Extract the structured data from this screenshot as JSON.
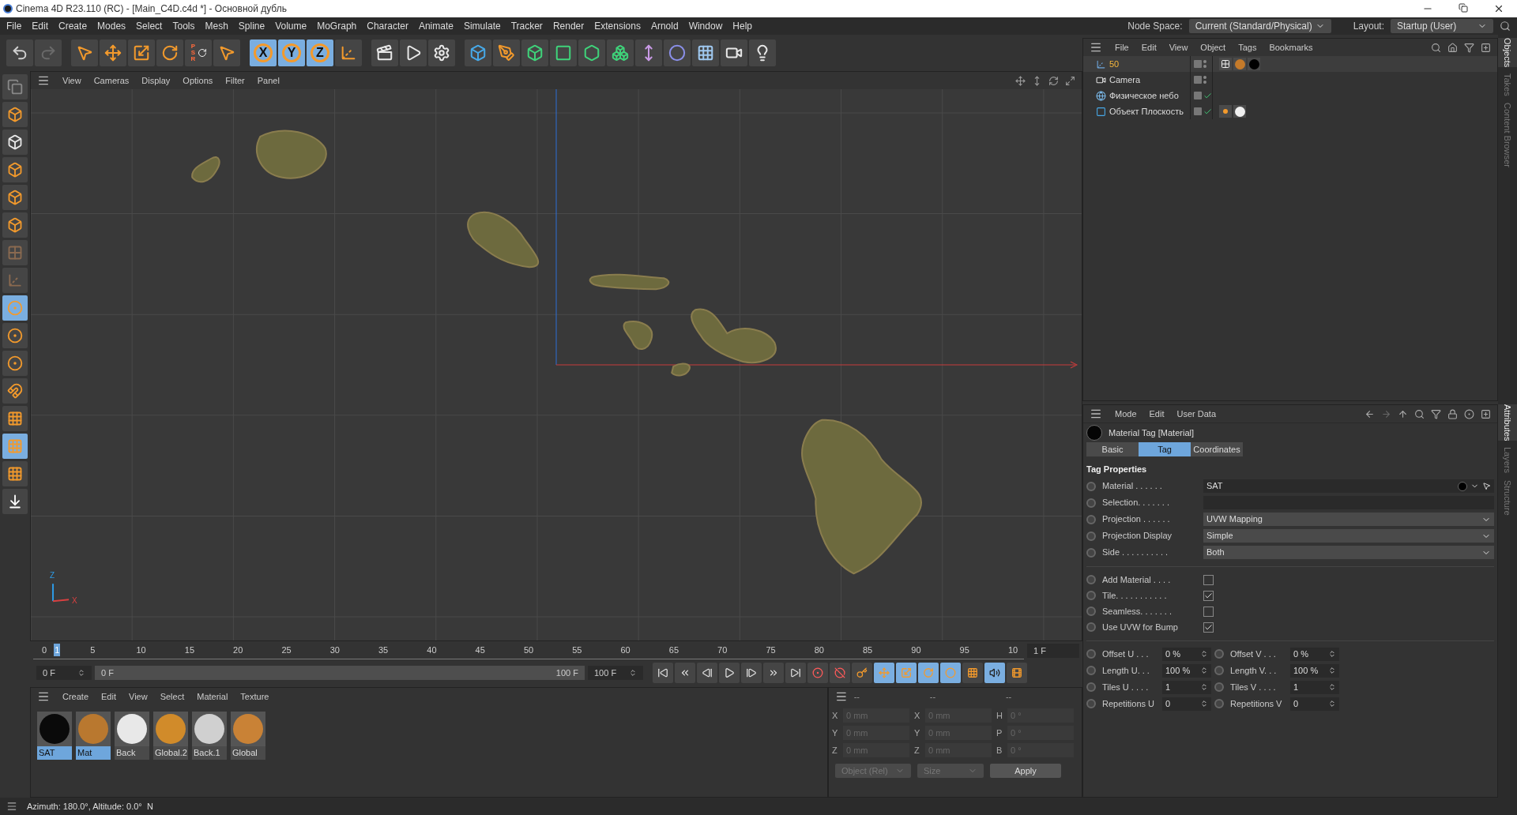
{
  "window": {
    "title": "Cinema 4D R23.110 (RC) - [Main_C4D.c4d *] - Основной дубль"
  },
  "menu": [
    "File",
    "Edit",
    "Create",
    "Modes",
    "Select",
    "Tools",
    "Mesh",
    "Spline",
    "Volume",
    "MoGraph",
    "Character",
    "Animate",
    "Simulate",
    "Tracker",
    "Render",
    "Extensions",
    "Arnold",
    "Window",
    "Help"
  ],
  "node_space": {
    "label": "Node Space:",
    "value": "Current (Standard/Physical)"
  },
  "layout": {
    "label": "Layout:",
    "value": "Startup (User)"
  },
  "toolbar": [
    {
      "kind": "undo",
      "selected": false
    },
    {
      "kind": "redo",
      "selected": false
    },
    {
      "kind": "select",
      "selected": false
    },
    {
      "kind": "move",
      "selected": false
    },
    {
      "kind": "scale",
      "selected": false
    },
    {
      "kind": "rotate",
      "selected": false
    },
    {
      "kind": "psr",
      "label": "PSR",
      "selected": false
    },
    {
      "kind": "live",
      "selected": false
    },
    {
      "kind": "axis",
      "label": "X",
      "selected": true
    },
    {
      "kind": "axis",
      "label": "Y",
      "selected": true
    },
    {
      "kind": "axis",
      "label": "Z",
      "selected": true
    },
    {
      "kind": "coord",
      "selected": false
    },
    {
      "kind": "render-view",
      "selected": false
    },
    {
      "kind": "render",
      "selected": false
    },
    {
      "kind": "render-settings",
      "selected": false
    },
    {
      "kind": "cube",
      "selected": false
    },
    {
      "kind": "pen",
      "selected": false
    },
    {
      "kind": "subdivision",
      "selected": false
    },
    {
      "kind": "extrude",
      "selected": false
    },
    {
      "kind": "cloner",
      "selected": false
    },
    {
      "kind": "array",
      "selected": false
    },
    {
      "kind": "deformer",
      "selected": false
    },
    {
      "kind": "field",
      "selected": false
    },
    {
      "kind": "floor",
      "selected": false
    },
    {
      "kind": "camera",
      "selected": false
    },
    {
      "kind": "light",
      "selected": false
    }
  ],
  "left_toolbar": [
    {
      "kind": "editable",
      "selected": false
    },
    {
      "kind": "model",
      "selected": false
    },
    {
      "kind": "texture",
      "selected": false
    },
    {
      "kind": "points",
      "selected": false
    },
    {
      "kind": "edges",
      "selected": false
    },
    {
      "kind": "polygons",
      "selected": false
    },
    {
      "kind": "uv",
      "selected": false
    },
    {
      "kind": "axis",
      "selected": false
    },
    {
      "kind": "snap",
      "selected": true
    },
    {
      "kind": "snap",
      "selected": false
    },
    {
      "kind": "snap",
      "selected": false
    },
    {
      "kind": "magnet",
      "selected": false
    },
    {
      "kind": "workplane",
      "selected": false
    },
    {
      "kind": "workplane",
      "selected": true
    },
    {
      "kind": "workplane",
      "selected": false
    },
    {
      "kind": "drop",
      "selected": false
    }
  ],
  "viewport": {
    "menu": [
      "View",
      "Cameras",
      "Display",
      "Options",
      "Filter",
      "Panel"
    ],
    "axis_labels": [
      "Z",
      "X"
    ]
  },
  "timeline": {
    "ticks": [
      "0",
      "5",
      "10",
      "15",
      "20",
      "25",
      "30",
      "35",
      "40",
      "45",
      "50",
      "55",
      "60",
      "65",
      "70",
      "75",
      "80",
      "85",
      "90",
      "95",
      "10"
    ],
    "current": {
      "label": "1",
      "level": 0.01
    },
    "frame_field": "1 F",
    "start": "0 F",
    "range": {
      "start": "0 F",
      "end": "100 F",
      "level": 1
    },
    "end": "100 F",
    "transport": [
      {
        "kind": "first",
        "selected": false
      },
      {
        "kind": "prev-key",
        "selected": false
      },
      {
        "kind": "prev",
        "selected": false
      },
      {
        "kind": "play",
        "selected": false
      },
      {
        "kind": "next",
        "selected": false
      },
      {
        "kind": "next-key",
        "selected": false
      },
      {
        "kind": "last",
        "selected": false
      },
      {
        "kind": "record",
        "selected": false
      },
      {
        "kind": "autokey",
        "selected": false
      },
      {
        "kind": "keysel",
        "selected": false
      },
      {
        "kind": "key-move",
        "selected": true
      },
      {
        "kind": "key-scale",
        "selected": true
      },
      {
        "kind": "key-rotate",
        "selected": true
      },
      {
        "kind": "key-param",
        "selected": true
      },
      {
        "kind": "key-points",
        "selected": false
      },
      {
        "kind": "sound",
        "selected": true
      },
      {
        "kind": "film",
        "selected": false
      }
    ]
  },
  "materials": {
    "menu": [
      "Create",
      "Edit",
      "View",
      "Select",
      "Material",
      "Texture"
    ],
    "items": [
      {
        "name": "SAT",
        "color": "#0a0a0a",
        "selected": true
      },
      {
        "name": "Mat",
        "color": "#b9782f",
        "selected": true
      },
      {
        "name": "Back",
        "color": "#e8e8e8",
        "selected": false
      },
      {
        "name": "Global.2",
        "color": "#d18b2a",
        "selected": false
      },
      {
        "name": "Back.1",
        "color": "#d0d0d0",
        "selected": false
      },
      {
        "name": "Global",
        "color": "#c98236",
        "selected": false
      }
    ]
  },
  "coordinates": {
    "headers": [
      "--",
      "--",
      "--"
    ],
    "rows": [
      [
        {
          "axis": "X",
          "value": "0 mm"
        },
        {
          "axis": "X",
          "value": "0 mm"
        },
        {
          "axis": "H",
          "value": "0 °"
        }
      ],
      [
        {
          "axis": "Y",
          "value": "0 mm"
        },
        {
          "axis": "Y",
          "value": "0 mm"
        },
        {
          "axis": "P",
          "value": "0 °"
        }
      ],
      [
        {
          "axis": "Z",
          "value": "0 mm"
        },
        {
          "axis": "Z",
          "value": "0 mm"
        },
        {
          "axis": "B",
          "value": "0 °"
        }
      ]
    ],
    "disabled": true,
    "mode": "Object (Rel)",
    "size": "Size",
    "apply": "Apply"
  },
  "objects": {
    "menu": [
      "File",
      "Edit",
      "View",
      "Object",
      "Tags",
      "Bookmarks"
    ],
    "items": [
      {
        "name": "50",
        "kind": "null",
        "selected": true,
        "check": false,
        "tags": [
          {
            "kind": "checker"
          },
          {
            "kind": "orange-ball"
          },
          {
            "kind": "black-ball"
          }
        ]
      },
      {
        "name": "Camera",
        "kind": "camera",
        "selected": false,
        "check": false
      },
      {
        "name": "Физическое небо",
        "kind": "sky",
        "selected": false,
        "check": true
      },
      {
        "name": "Объект Плоскость",
        "kind": "plane",
        "selected": false,
        "check": true,
        "tags": [
          {
            "kind": "dots"
          },
          {
            "kind": "white-ball"
          }
        ]
      }
    ]
  },
  "right_tabs_top": [
    {
      "label": "Objects",
      "selected": true
    },
    {
      "label": "Takes",
      "selected": false
    },
    {
      "label": "Content Browser",
      "selected": false
    }
  ],
  "attributes": {
    "menu": [
      "Mode",
      "Edit",
      "User Data"
    ],
    "title": "Material Tag [Material]",
    "tabs": [
      {
        "label": "Basic",
        "selected": false
      },
      {
        "label": "Tag",
        "selected": true
      },
      {
        "label": "Coordinates",
        "selected": false
      }
    ],
    "section": "Tag Properties",
    "fields": [
      {
        "kind": "link",
        "label": "Material . . . . . .",
        "value": "SAT"
      },
      {
        "kind": "text",
        "label": "Selection. . . . . . ."
      },
      {
        "kind": "dropdown",
        "label": "Projection . . . . . .",
        "value": "UVW Mapping"
      },
      {
        "kind": "dropdown",
        "label": "Projection Display",
        "value": "Simple"
      },
      {
        "kind": "dropdown",
        "label": "Side . . . . . . . . . .",
        "value": "Both"
      }
    ],
    "checks": [
      {
        "label": "Add Material . . . .",
        "checked": false
      },
      {
        "label": "Tile. . . . . . . . . . .",
        "checked": true
      },
      {
        "label": "Seamless. . . . . . .",
        "checked": false
      },
      {
        "label": "Use UVW for Bump",
        "checked": true
      }
    ],
    "numbers": [
      [
        {
          "label": "Offset U . . .",
          "value": "0 %"
        },
        {
          "label": "Offset V . . .",
          "value": "0 %"
        }
      ],
      [
        {
          "label": "Length U. . .",
          "value": "100 %"
        },
        {
          "label": "Length V. . .",
          "value": "100 %"
        }
      ],
      [
        {
          "label": "Tiles U . . . .",
          "value": "1"
        },
        {
          "label": "Tiles V . . . .",
          "value": "1"
        }
      ],
      [
        {
          "label": "Repetitions U",
          "value": "0"
        },
        {
          "label": "Repetitions V",
          "value": "0"
        }
      ]
    ]
  },
  "right_tabs_bottom": [
    {
      "label": "Attributes",
      "selected": true
    },
    {
      "label": "Layers",
      "selected": false
    },
    {
      "label": "Structure",
      "selected": false
    }
  ],
  "status_bar": "Azimuth: 180.0°, Altitude: 0.0°  N"
}
